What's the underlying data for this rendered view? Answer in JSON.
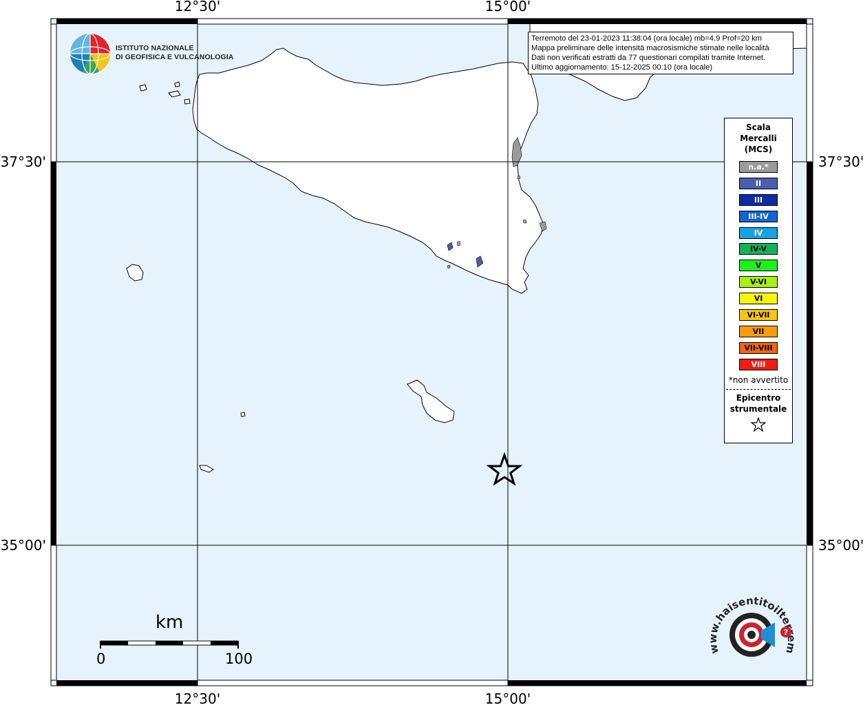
{
  "graticule": {
    "top_labels": [
      "12°30'",
      "15°00'"
    ],
    "bottom_labels": [
      "12°30'",
      "15°00'"
    ],
    "left_labels": [
      "37°30'",
      "35°00'"
    ],
    "right_labels": [
      "37°30'",
      "35°00'"
    ]
  },
  "info_box": {
    "lines": [
      "Terremoto del 23-01-2023 11:38:04 (ora locale) mb=4.9 Prof=20 km",
      "Mappa preliminare delle intensità macrosismiche stimate nelle località",
      "Dati non verificati estratti da 77 questionari compilati tramite Internet.",
      "Ultimo aggiornamento: 15-12-2025 00:10 (ora locale)"
    ]
  },
  "legend": {
    "title_lines": [
      "Scala",
      "Mercalli",
      "(MCS)"
    ],
    "items": [
      {
        "label": "n.a.*",
        "color": "#9b9b9b",
        "text_color": "#ffffff"
      },
      {
        "label": "II",
        "color": "#4a5fae",
        "text_color": "#ffffff"
      },
      {
        "label": "III",
        "color": "#0d2ca6",
        "text_color": "#ffffff"
      },
      {
        "label": "III-IV",
        "color": "#1064d6",
        "text_color": "#ffffff"
      },
      {
        "label": "IV",
        "color": "#14a3e6",
        "text_color": "#ffffff"
      },
      {
        "label": "IV-V",
        "color": "#13b25a",
        "text_color": "#000000"
      },
      {
        "label": "V",
        "color": "#1ef01e",
        "text_color": "#000000"
      },
      {
        "label": "V-VI",
        "color": "#a6f013",
        "text_color": "#000000"
      },
      {
        "label": "VI",
        "color": "#f7f50d",
        "text_color": "#000000"
      },
      {
        "label": "VI-VII",
        "color": "#fbc40c",
        "text_color": "#000000"
      },
      {
        "label": "VII",
        "color": "#fb9b0d",
        "text_color": "#000000"
      },
      {
        "label": "VII-VIII",
        "color": "#f7650e",
        "text_color": "#000000"
      },
      {
        "label": "VIII",
        "color": "#f01e12",
        "text_color": "#ffffff"
      }
    ],
    "note": "*non avvertito",
    "epicenter_lines": [
      "Epicentro",
      "strumentale"
    ]
  },
  "scale_bar": {
    "unit": "km",
    "start": "0",
    "end": "100"
  },
  "logos": {
    "ingv_lines": [
      "ISTITUTO NAZIONALE",
      "DI GEOFISICA E VULCANOLOGIA"
    ],
    "hsit_text": "www.haisentitoilterremoto.it"
  },
  "colors": {
    "sea": "#e6f3fd",
    "land": "#ffffff",
    "frame": "#000000"
  }
}
